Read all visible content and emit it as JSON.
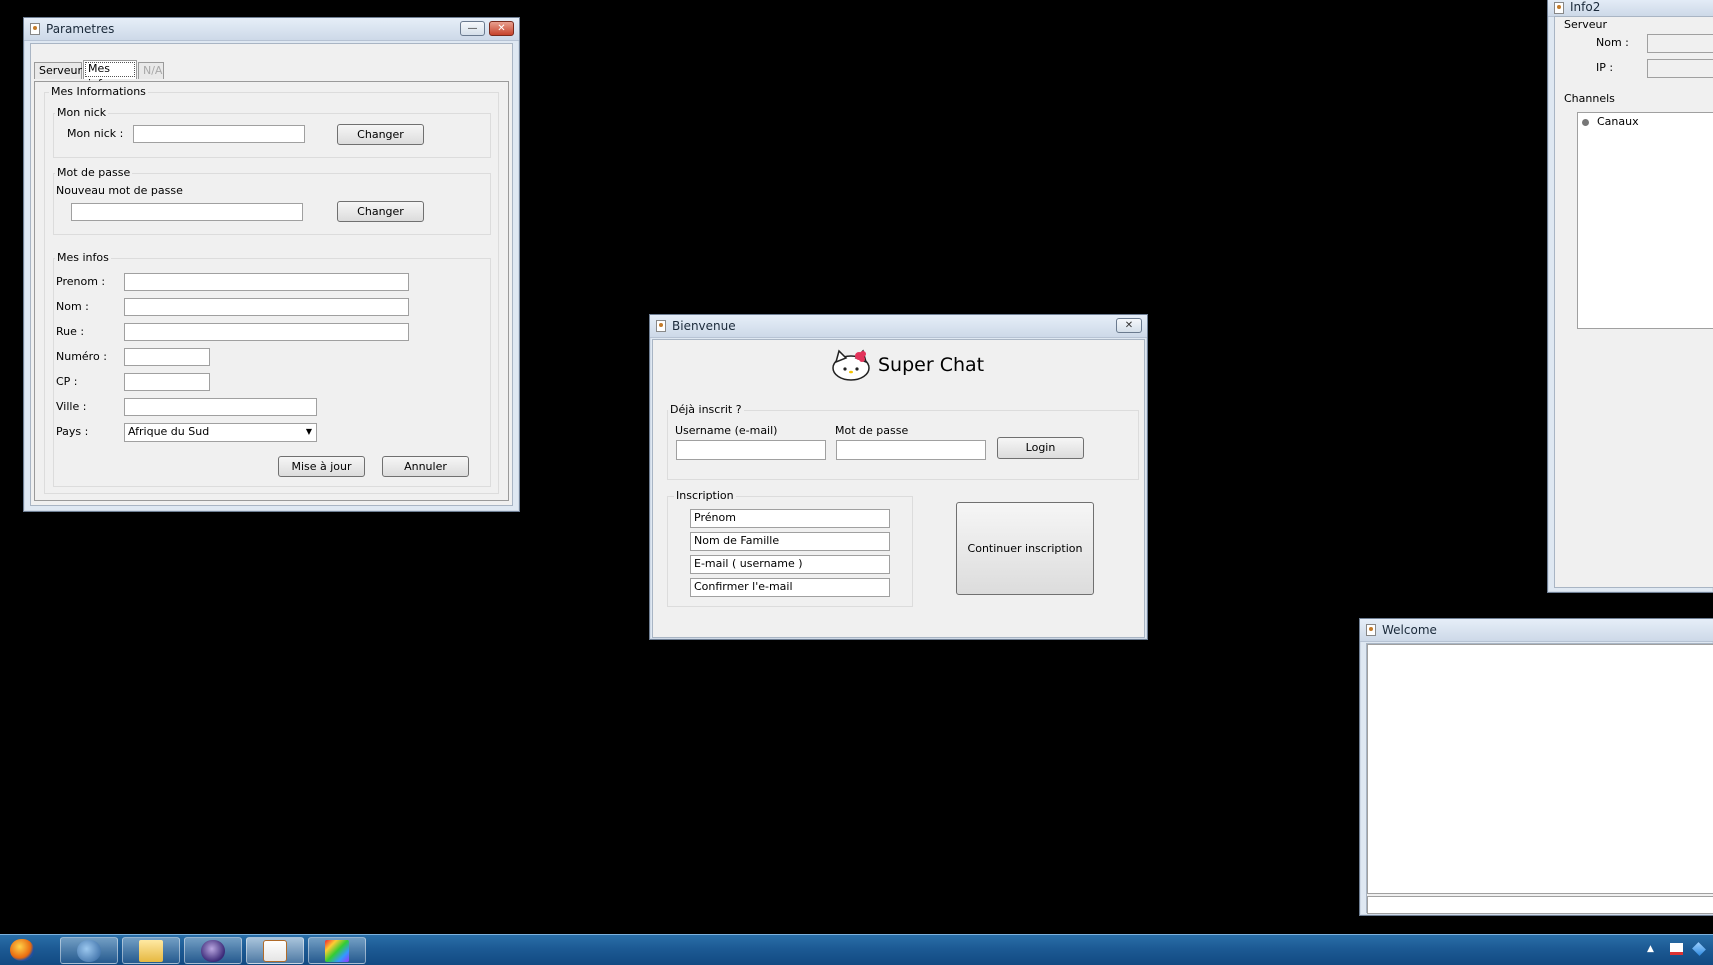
{
  "parametres": {
    "title": "Parametres",
    "tabs": [
      "Serveur",
      "Mes infos",
      "N/A"
    ],
    "section_title": "Mes Informations",
    "nick_group": "Mon nick",
    "nick_label": "Mon nick :",
    "nick_value": "",
    "change_label": "Changer",
    "password_group": "Mot de passe",
    "new_password_label": "Nouveau mot de passe",
    "password_value": "",
    "infos_group": "Mes infos",
    "fields": {
      "prenom": {
        "label": "Prenom :",
        "value": ""
      },
      "nom": {
        "label": "Nom :",
        "value": ""
      },
      "rue": {
        "label": "Rue :",
        "value": ""
      },
      "numero": {
        "label": "Numéro :",
        "value": ""
      },
      "cp": {
        "label": "CP :",
        "value": ""
      },
      "ville": {
        "label": "Ville :",
        "value": ""
      },
      "pays": {
        "label": "Pays :",
        "value": "Afrique du Sud"
      }
    },
    "update_label": "Mise à jour",
    "cancel_label": "Annuler"
  },
  "bienvenue": {
    "title": "Bienvenue",
    "app_name": "Super Chat",
    "already_group": "Déjà inscrit ?",
    "username_label": "Username (e-mail)",
    "username_value": "",
    "password_label": "Mot de passe",
    "password_value": "",
    "login_label": "Login",
    "inscription_group": "Inscription",
    "inscription_fields": [
      "Prénom",
      "Nom de Famille",
      "E-mail ( username )",
      "Confirmer l'e-mail"
    ],
    "continue_label": "Continuer inscription"
  },
  "info2": {
    "title": "Info2",
    "server_group": "Serveur",
    "nom_label": "Nom :",
    "ip_label": "IP :",
    "channels_group": "Channels",
    "tree_root": "Canaux"
  },
  "welcome": {
    "title": "Welcome"
  },
  "taskbar": {
    "apps": [
      "firefox-icon",
      "thunderbird-icon",
      "file-explorer-icon",
      "eclipse-icon",
      "java-icon",
      "color-app-icon"
    ],
    "tray": [
      "show-hidden-icons",
      "action-center-icon",
      "dropbox-icon"
    ]
  },
  "colors": {
    "desktop": "#000000",
    "taskbar": "#1c5a94",
    "window_frame": "#dfe8f2",
    "client": "#f0f0f0"
  }
}
